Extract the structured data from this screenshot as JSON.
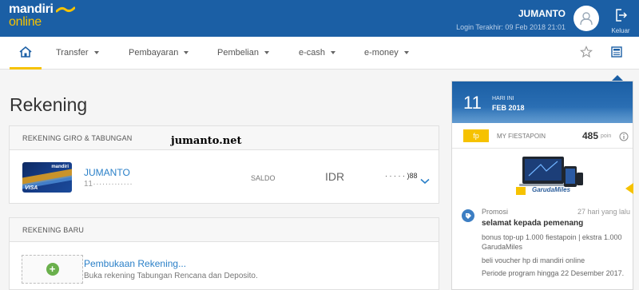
{
  "header": {
    "logo_top": "mandiri",
    "logo_bottom": "online",
    "user_name": "JUMANTO",
    "last_login": "Login Terakhir: 09 Feb 2018 21:01",
    "logout_label": "Keluar"
  },
  "nav": {
    "items": [
      {
        "label": "Transfer"
      },
      {
        "label": "Pembayaran"
      },
      {
        "label": "Pembelian"
      },
      {
        "label": "e-cash"
      },
      {
        "label": "e-money"
      }
    ]
  },
  "main": {
    "title": "Rekening",
    "accounts_section": {
      "header": "REKENING GIRO & TABUNGAN",
      "card_brand": "mandiri",
      "card_network": "VISA",
      "account_name": "JUMANTO",
      "account_number": "11·············",
      "saldo_label": "SALDO",
      "currency": "IDR",
      "amount_suffix": "·  ·  ·  ·  ·  )88"
    },
    "watermark": "jumanto.net",
    "new_account_section": {
      "header": "REKENING BARU",
      "title": "Pembukaan Rekening...",
      "description": "Buka rekening Tabungan Rencana dan Deposito."
    }
  },
  "side": {
    "day": "11",
    "today_label": "HARI INI",
    "month_year": "FEB 2018",
    "fp_badge": "fp",
    "fp_label": "MY FIESTAPOIN",
    "fp_points": "485",
    "fp_unit": "poin",
    "promo_brand": "GarudaMiles",
    "promo_type": "Promosi",
    "promo_time": "27 hari yang lalu",
    "promo_title": "selamat kepada pemenang",
    "promo_line1": "bonus top-up 1.000 fiestapoin | ekstra 1.000 GarudaMiles",
    "promo_line2": "beli voucher hp di mandiri online",
    "promo_line3": "Periode program hingga 22 Desember 2017."
  },
  "colors": {
    "header_blue": "#1b5fa5",
    "accent_yellow": "#f6c200",
    "link_blue": "#2b80c8",
    "plus_green": "#6ab04c"
  }
}
